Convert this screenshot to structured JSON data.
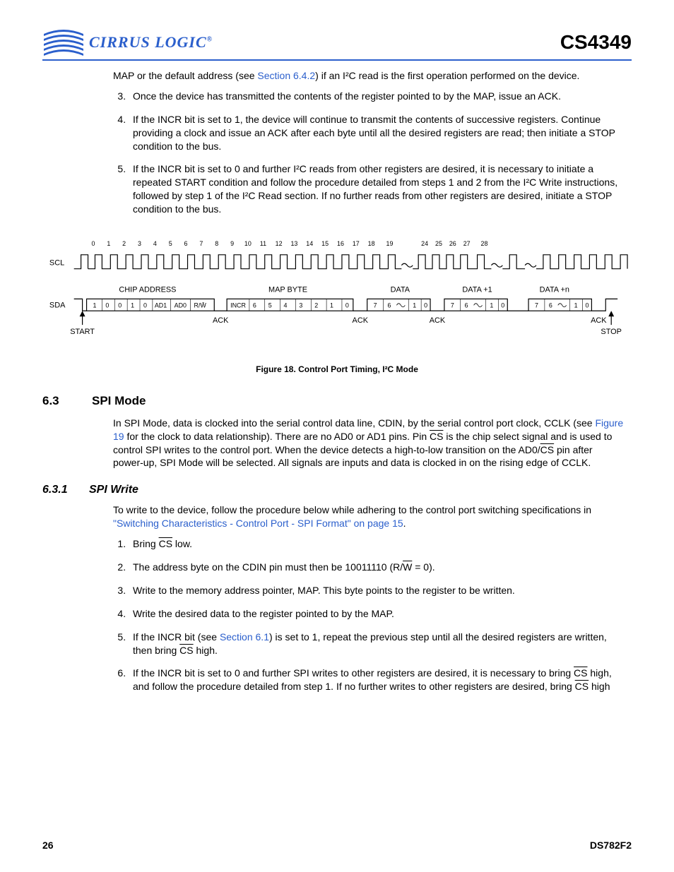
{
  "header": {
    "brand": "CIRRUS LOGIC",
    "product": "CS4349"
  },
  "intro_para": {
    "pre": "MAP or the default address (see ",
    "link": "Section 6.4.2",
    "post": ") if an I²C read is the first operation performed on the device."
  },
  "list_a": {
    "item3": "Once the device has transmitted the contents of the register pointed to by the MAP, issue an ACK.",
    "item4": "If the INCR bit is set to 1, the device will continue to transmit the contents of successive registers. Continue providing a clock and issue an ACK after each byte until all the desired registers are read; then initiate a STOP condition to the bus.",
    "item5": "If the INCR bit is set to 0 and further I²C reads from other registers are desired, it is necessary to initiate a repeated START condition and follow the procedure detailed from steps 1 and 2 from the I²C Write instructions, followed by step 1 of the I²C Read section. If no further reads from other registers are desired, initiate a STOP condition to the bus."
  },
  "diagram": {
    "scl": "SCL",
    "sda": "SDA",
    "ticks": [
      "0",
      "1",
      "2",
      "3",
      "4",
      "5",
      "6",
      "7",
      "8",
      "9",
      "10",
      "11",
      "12",
      "13",
      "14",
      "15",
      "16",
      "17",
      "18",
      "19",
      "24",
      "25",
      "26",
      "27",
      "28"
    ],
    "chip_address": "CHIP ADDRESS",
    "map_byte": "MAP BYTE",
    "data": "DATA",
    "data1": "DATA +1",
    "datan": "DATA +n",
    "ack": "ACK",
    "start": "START",
    "stop": "STOP",
    "addr_bits": [
      "1",
      "0",
      "0",
      "1",
      "0",
      "AD1",
      "AD0",
      "R/W̄"
    ],
    "map_bits": [
      "INCR",
      "6",
      "5",
      "4",
      "3",
      "2",
      "1",
      "0"
    ],
    "data_bits": [
      "7",
      "6",
      "1",
      "0"
    ]
  },
  "fig_caption": "Figure 18.  Control Port Timing, I²C Mode",
  "sec63": {
    "num": "6.3",
    "title": "SPI Mode",
    "para_pre": "In SPI Mode, data is clocked into the serial control data line, CDIN, by the serial control port clock, CCLK (see ",
    "para_link": "Figure 19",
    "para_mid1": " for the clock to data relationship). There are no AD0 or AD1 pins. Pin ",
    "para_cs": "CS",
    "para_mid2": " is the chip select signal and is used to control SPI writes to the control port. When the device detects a high-to-low transition on the AD0/",
    "para_mid3": " pin after power-up, SPI Mode will be selected. All signals are inputs and data is clocked in on the rising edge of CCLK."
  },
  "sec631": {
    "num": "6.3.1",
    "title": "SPI Write",
    "intro_pre": "To write to the device, follow the procedure below while adhering to the control port switching specifications in ",
    "intro_link": "\"Switching Characteristics - Control Port - SPI Format\" on page 15",
    "intro_post": ".",
    "steps": {
      "s1_pre": "Bring ",
      "s1_cs": "CS",
      "s1_post": " low.",
      "s2_pre": "The address byte on the CDIN pin must then be 10011110 (R/",
      "s2_w": "W",
      "s2_post": " = 0).",
      "s3": "Write to the memory address pointer, MAP. This byte points to the register to be written.",
      "s4": "Write the desired data to the register pointed to by the MAP.",
      "s5_pre": "If the INCR bit (see ",
      "s5_link": "Section 6.1",
      "s5_mid": ") is set to 1, repeat the previous step until all the desired registers are written, then bring ",
      "s5_cs": "CS",
      "s5_post": " high.",
      "s6_pre": "If the INCR bit is set to 0 and further SPI writes to other registers are desired, it is necessary to bring ",
      "s6_cs": "CS",
      "s6_mid": " high, and follow the procedure detailed from step 1. If no further writes to other registers are desired, bring ",
      "s6_post": " high"
    }
  },
  "footer": {
    "page": "26",
    "doc": "DS782F2"
  }
}
